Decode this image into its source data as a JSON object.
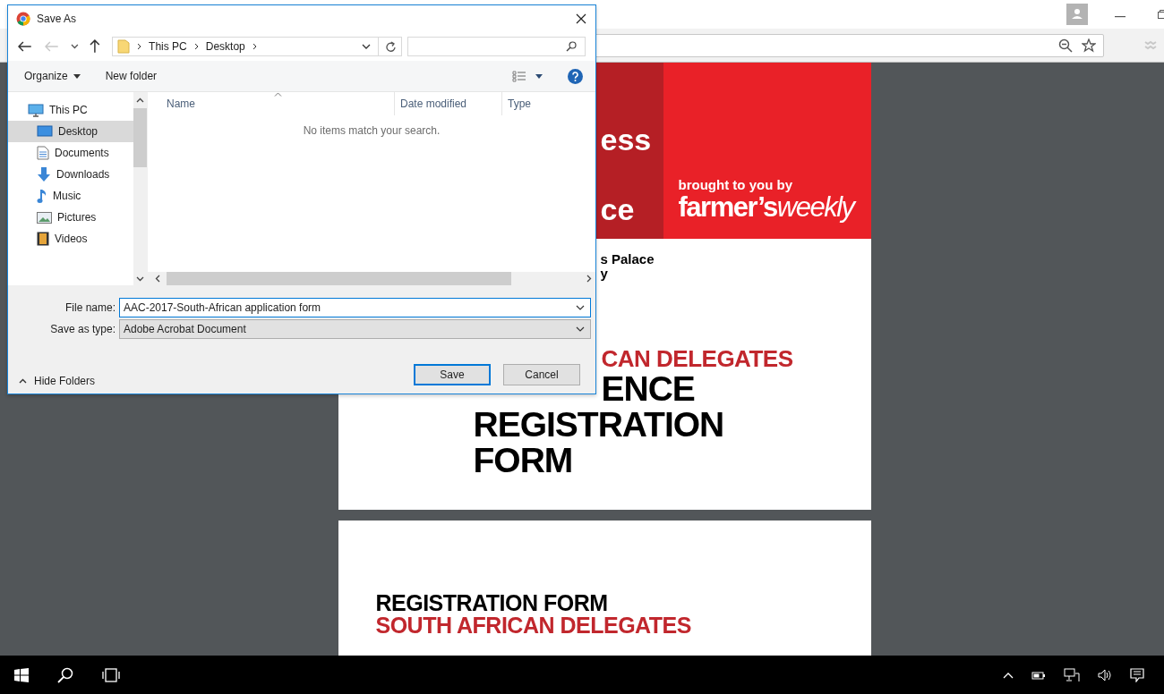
{
  "document": {
    "pages": [
      {
        "kind": "cover",
        "header_lines": [
          "ess",
          "ce"
        ],
        "tagline": "brought to you by",
        "brand": [
          "farmer’s",
          "weekly"
        ],
        "venue_lines": [
          "s Palace",
          "y"
        ],
        "subtitle": "CAN DELEGATES",
        "title_lines": [
          "ENCE",
          "REGISTRATION",
          "FORM"
        ]
      },
      {
        "kind": "form",
        "title": "REGISTRATION FORM",
        "subtitle": "SOUTH AFRICAN DELEGATES"
      }
    ]
  },
  "dialog": {
    "title": "Save As",
    "nav_buttons": [
      {
        "kind": "back",
        "disabled": false
      },
      {
        "kind": "forward",
        "disabled": true
      },
      {
        "kind": "recent",
        "disabled": false
      },
      {
        "kind": "up",
        "disabled": false
      }
    ],
    "breadcrumb": [
      "This PC",
      "Desktop"
    ],
    "toolbar": {
      "organize": "Organize",
      "new_folder": "New folder"
    },
    "nav_pane": {
      "items": [
        {
          "label": "This PC",
          "kind": "pc",
          "selected": false,
          "children": [
            {
              "label": "Desktop",
              "kind": "desktop",
              "selected": true
            },
            {
              "label": "Documents",
              "kind": "documents",
              "selected": false
            },
            {
              "label": "Downloads",
              "kind": "downloads",
              "selected": false
            },
            {
              "label": "Music",
              "kind": "music",
              "selected": false
            },
            {
              "label": "Pictures",
              "kind": "pictures",
              "selected": false
            },
            {
              "label": "Videos",
              "kind": "videos",
              "selected": false
            }
          ]
        }
      ]
    },
    "columns": [
      "Name",
      "Date modified",
      "Type"
    ],
    "empty_message": "No items match your search.",
    "file_name": {
      "label": "File name:",
      "value": "AAC-2017-South-African application form"
    },
    "save_as_type": {
      "label": "Save as type:",
      "value": "Adobe Acrobat Document"
    },
    "hide_folders": "Hide Folders",
    "buttons": [
      {
        "label": "Save",
        "default": true
      },
      {
        "label": "Cancel",
        "default": false
      }
    ]
  }
}
